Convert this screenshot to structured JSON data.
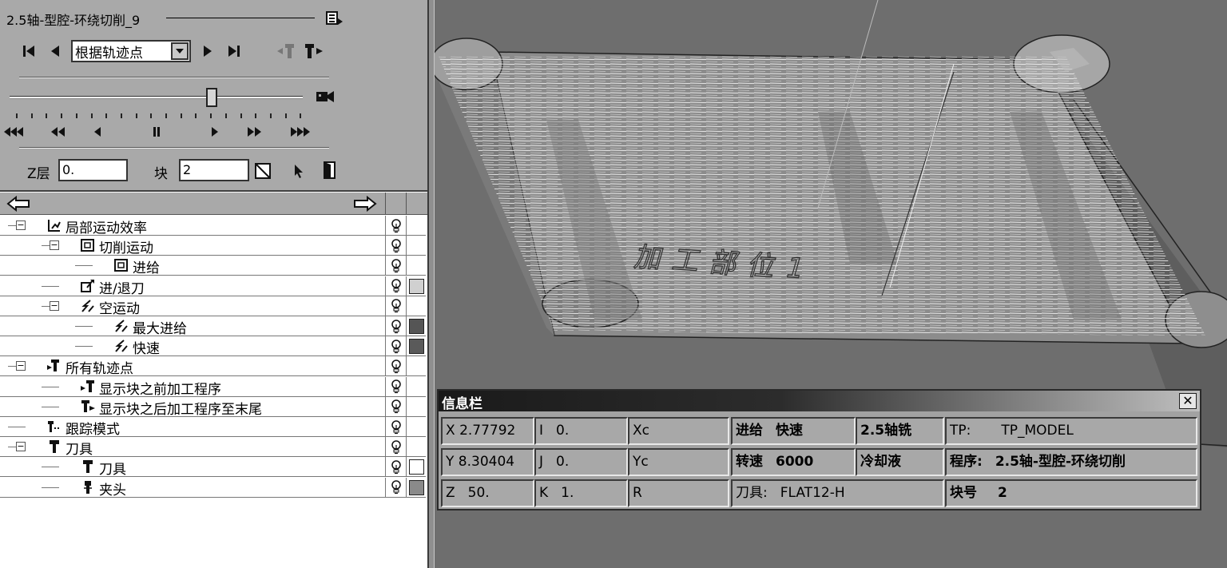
{
  "player": {
    "title": "2.5轴-型腔-环绕切削_9",
    "mode_select": "根据轨迹点",
    "z_label": "Z层",
    "z_value": "0.",
    "block_label": "块",
    "block_value": "2"
  },
  "tree": {
    "rows": [
      {
        "label": "局部运动效率"
      },
      {
        "label": "切削运动"
      },
      {
        "label": "进给"
      },
      {
        "label": "进/退刀",
        "color": "#d0d0d0"
      },
      {
        "label": "空运动"
      },
      {
        "label": "最大进给",
        "color": "#555555"
      },
      {
        "label": "快速",
        "color": "#5a5a5a"
      },
      {
        "label": "所有轨迹点"
      },
      {
        "label": "显示块之前加工程序"
      },
      {
        "label": "显示块之后加工程序至末尾"
      },
      {
        "label": "跟踪模式"
      },
      {
        "label": "刀具"
      },
      {
        "label": "刀具",
        "color": "#ffffff"
      },
      {
        "label": "夹头",
        "color": "#8a8a8a"
      }
    ]
  },
  "view": {
    "engraving": "加工部位1"
  },
  "info": {
    "title": "信息栏",
    "close": "✕",
    "x_label": "X",
    "x_value": "2.77792",
    "y_label": "Y",
    "y_value": "8.30404",
    "z_label": "Z",
    "z_value": "50.",
    "i_label": "I",
    "i_value": "0.",
    "j_label": "J",
    "j_value": "0.",
    "k_label": "K",
    "k_value": "1.",
    "xc_label": "Xc",
    "yc_label": "Yc",
    "r_label": "R",
    "feed_label": "进给",
    "feed_value": "快速",
    "speed_label": "转速",
    "speed_value": "6000",
    "tool_label": "刀具:",
    "tool_value": "FLAT12-H",
    "mill_type": "2.5轴铣",
    "coolant": "冷却液",
    "tp_label": "TP:",
    "tp_value": "TP_MODEL",
    "program_label": "程序:",
    "program_value": "2.5轴-型腔-环绕切削",
    "block_label": "块号",
    "block_value": "2"
  }
}
